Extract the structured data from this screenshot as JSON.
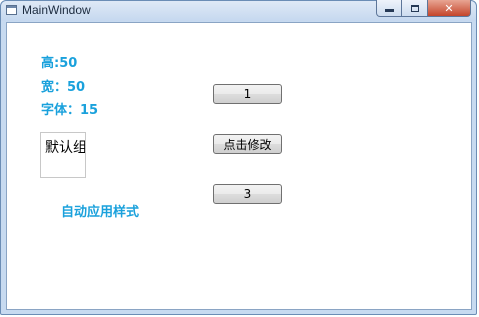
{
  "window": {
    "title": "MainWindow",
    "icon": "window-app-icon",
    "controls": {
      "minimize": "minimize-icon",
      "maximize": "maximize-icon",
      "close": "✕"
    }
  },
  "labels": {
    "height": "高:50",
    "width": "宽：50",
    "font": "字体：15",
    "auto_style": "自动应用样式"
  },
  "textbox": {
    "value": "默认组"
  },
  "buttons": {
    "button1": "1",
    "edit_button": "点击修改",
    "button3": "3"
  },
  "colors": {
    "label_text": "#1aa1dc",
    "title_bar": "#c5d8ef",
    "close_button": "#c4452a"
  }
}
